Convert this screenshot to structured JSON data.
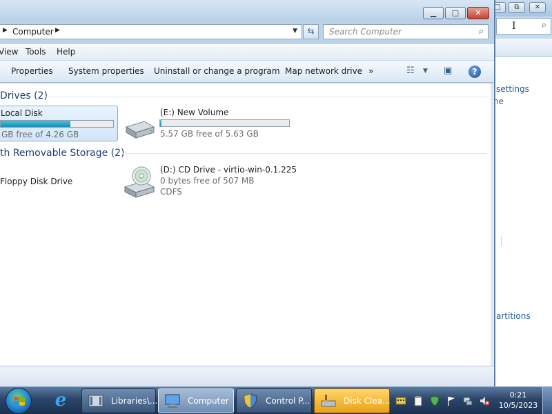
{
  "background_window": {
    "links": [
      "settings",
      "ne",
      "artitions"
    ]
  },
  "explorer": {
    "address": {
      "crumb": "Computer"
    },
    "search": {
      "placeholder": "Search Computer"
    },
    "menu": [
      "View",
      "Tools",
      "Help"
    ],
    "commands": [
      "Properties",
      "System properties",
      "Uninstall or change a program",
      "Map network drive",
      "»"
    ],
    "groups": {
      "hard_drives": {
        "header": "Drives (2)"
      },
      "removable": {
        "header": "th Removable Storage (2)"
      }
    },
    "drives": {
      "local_disk": {
        "name": "Local Disk",
        "info": "GB free of 4.26 GB",
        "fill_fraction": 0.62
      },
      "new_volume": {
        "name": "(E:) New Volume",
        "info": "5.57 GB free of 5.63 GB",
        "fill_fraction": 0.01
      },
      "floppy": {
        "name": "Floppy Disk Drive"
      },
      "cd": {
        "name": "(D:) CD Drive - virtio-win-0.1.225",
        "info": "0 bytes free of 507 MB",
        "fs": "CDFS"
      }
    }
  },
  "taskbar": {
    "tasks": [
      {
        "label": "Libraries\\...",
        "state": "normal"
      },
      {
        "label": "Computer",
        "state": "active"
      },
      {
        "label": "Control P...",
        "state": "normal"
      },
      {
        "label": "Disk Clea...",
        "state": "highlight"
      }
    ],
    "clock": {
      "time": "0:21",
      "date": "10/5/2023"
    }
  },
  "colors": {
    "accent": "#1e3f73",
    "progress": "#1a8bb0",
    "taskbar": "#2b4568"
  },
  "icons": [
    "search-icon",
    "refresh-icon",
    "views-icon",
    "preview-pane-icon",
    "help-icon",
    "hard-disk-icon",
    "cd-drive-icon",
    "start-orb-icon",
    "internet-explorer-icon"
  ]
}
